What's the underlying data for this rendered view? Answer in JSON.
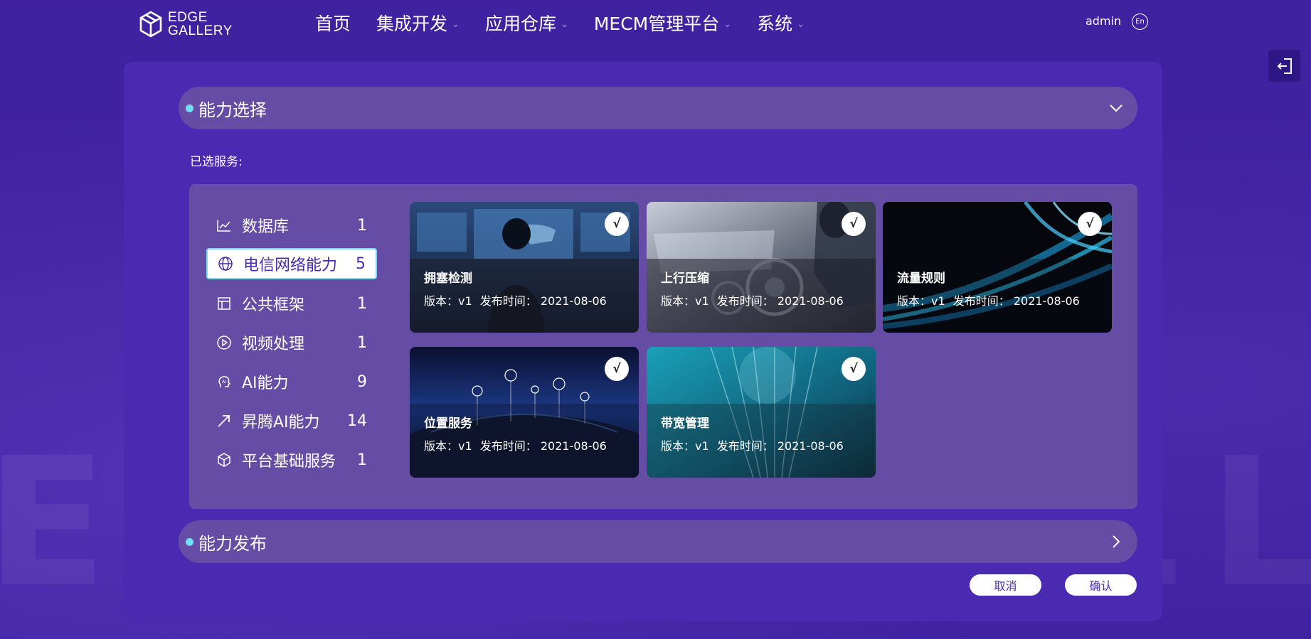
{
  "watermark": "EDGE GALLERY",
  "header": {
    "logo_line1": "EDGE",
    "logo_line2": "GALLERY",
    "nav": [
      {
        "label": "首页",
        "has_dropdown": false
      },
      {
        "label": "集成开发",
        "has_dropdown": true
      },
      {
        "label": "应用仓库",
        "has_dropdown": true
      },
      {
        "label": "MECM管理平台",
        "has_dropdown": true
      },
      {
        "label": "系统",
        "has_dropdown": true
      }
    ],
    "caret": "⌄",
    "user": "admin",
    "lang": "En"
  },
  "capability_select": {
    "title": "能力选择",
    "expanded": true,
    "selected_label": "已选服务:",
    "categories": [
      {
        "label": "数据库",
        "count": "1",
        "icon": "chart-line-icon",
        "active": false
      },
      {
        "label": "电信网络能力",
        "count": "5",
        "icon": "globe-icon",
        "active": true
      },
      {
        "label": "公共框架",
        "count": "1",
        "icon": "layout-icon",
        "active": false
      },
      {
        "label": "视频处理",
        "count": "1",
        "icon": "play-circle-icon",
        "active": false
      },
      {
        "label": "AI能力",
        "count": "9",
        "icon": "ai-head-icon",
        "active": false
      },
      {
        "label": "昇腾AI能力",
        "count": "14",
        "icon": "arrow-up-right-icon",
        "active": false
      },
      {
        "label": "平台基础服务",
        "count": "1",
        "icon": "cube-icon",
        "active": false
      }
    ],
    "services": [
      {
        "name": "拥塞检测",
        "version": "版本：v1",
        "date": "发布时间： 2021-08-06",
        "checked": true,
        "check": "√",
        "theme": "operations-room"
      },
      {
        "name": "上行压缩",
        "version": "版本：v1",
        "date": "发布时间： 2021-08-06",
        "checked": true,
        "check": "√",
        "theme": "gears-screen"
      },
      {
        "name": "流量规则",
        "version": "版本：v1",
        "date": "发布时间： 2021-08-06",
        "checked": true,
        "check": "√",
        "theme": "light-streams"
      },
      {
        "name": "位置服务",
        "version": "版本：v1",
        "date": "发布时间： 2021-08-06",
        "checked": true,
        "check": "√",
        "theme": "city-icons"
      },
      {
        "name": "带宽管理",
        "version": "版本：v1",
        "date": "发布时间： 2021-08-06",
        "checked": true,
        "check": "√",
        "theme": "fiber-optics"
      }
    ]
  },
  "capability_publish": {
    "title": "能力发布",
    "expanded": false
  },
  "buttons": {
    "cancel": "取消",
    "confirm": "确认"
  },
  "colors": {
    "background": "#3f22a0",
    "panel": "#4a2ab0",
    "section_bar": "#654da6",
    "accent_dot": "#6fe0f0"
  }
}
